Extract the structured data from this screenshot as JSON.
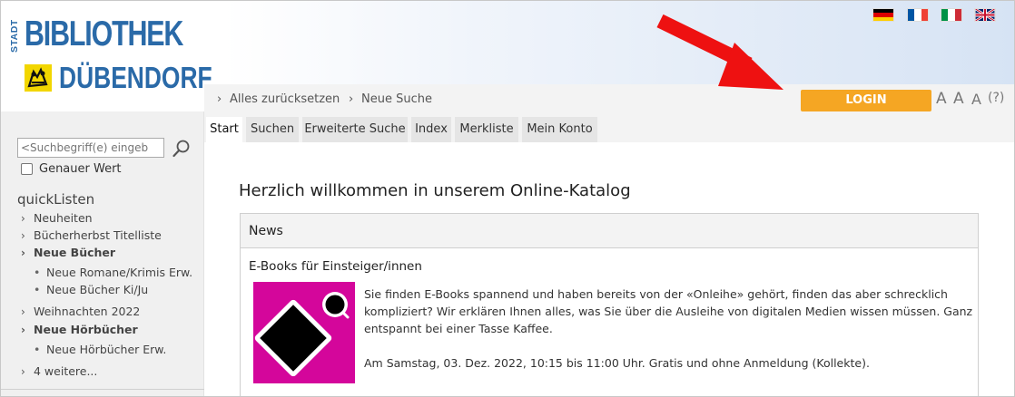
{
  "header": {
    "logo": {
      "stadt": "STADT",
      "line1": "BIBLIOTHEK",
      "line2": "DÜBENDORF"
    },
    "languages": [
      {
        "name": "german-flag-icon",
        "colors": [
          "#000000",
          "#dd0000",
          "#ffce00"
        ]
      },
      {
        "name": "french-flag-icon",
        "colors": [
          "#0055a4",
          "#ffffff",
          "#ef4135"
        ]
      },
      {
        "name": "italian-flag-icon",
        "colors": [
          "#009246",
          "#ffffff",
          "#ce2b37"
        ]
      },
      {
        "name": "uk-flag-icon",
        "colors": [
          "#012169",
          "#ffffff",
          "#c8102e"
        ]
      }
    ]
  },
  "toolbar": {
    "reset_label": "Alles zurücksetzen",
    "new_search_label": "Neue Suche",
    "login_label": "LOGIN",
    "font_size_small": "A",
    "font_size_medium": "A",
    "font_size_large": "A",
    "help_label": "(?)"
  },
  "tabs": [
    "Start",
    "Suchen",
    "Erweiterte Suche",
    "Index",
    "Merkliste",
    "Mein Konto"
  ],
  "sidebar": {
    "search_placeholder": "<Suchbegriff(e) eingeb",
    "exact_label": "Genauer Wert",
    "quicklists_title": "quickListen",
    "items": [
      {
        "label": "Neuheiten"
      },
      {
        "label": "Bücherherbst Titelliste"
      },
      {
        "label": "Neue Bücher"
      },
      {
        "label": "Neue Romane/Krimis Erw."
      },
      {
        "label": "Neue Bücher Ki/Ju"
      },
      {
        "label": "Weihnachten 2022"
      },
      {
        "label": "Neue Hörbücher"
      },
      {
        "label": "Neue Hörbücher Erw."
      },
      {
        "label": "4 weitere..."
      }
    ]
  },
  "main": {
    "welcome": "Herzlich willkommen in unserem Online-Katalog",
    "news_title": "News",
    "article": {
      "title": "E-Books für Einsteiger/innen",
      "lines": [
        "Sie finden E-Books spannend und haben bereits von der «Onleihe» gehört, finden das aber schrecklich",
        "kompliziert? Wir erklären Ihnen alles, was Sie über die Ausleihe von digitalen Medien wissen müssen. Ganz",
        "entspannt bei einer Tasse Kaffee.",
        "Am Samstag, 03. Dez. 2022, 10:15 bis 11:00 Uhr. Gratis und ohne Anmeldung (Kollekte)."
      ]
    }
  },
  "colors": {
    "brand_blue": "#2a6aa8",
    "login_orange": "#f5a623",
    "arrow_red": "#ee1111",
    "article_magenta": "#d4069b"
  }
}
